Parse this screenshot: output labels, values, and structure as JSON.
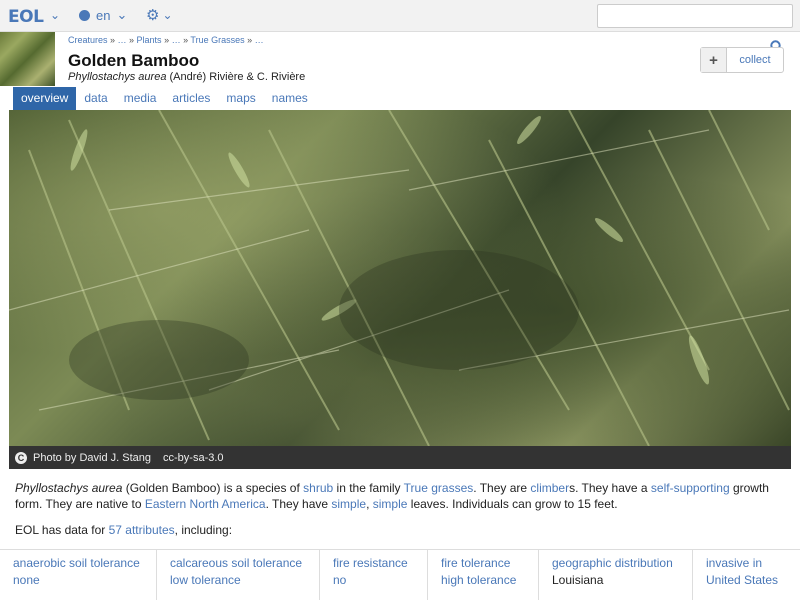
{
  "topbar": {
    "logo": "EOL",
    "language": "en"
  },
  "header": {
    "breadcrumb": [
      "Creatures",
      "…",
      "Plants",
      "…",
      "True Grasses",
      "…"
    ],
    "title": "Golden Bamboo",
    "scientific_name": "Phyllostachys aurea",
    "authority": "(André) Rivière & C. Rivière",
    "collect_label": "collect"
  },
  "tabs": [
    {
      "label": "overview",
      "active": true
    },
    {
      "label": "data",
      "active": false
    },
    {
      "label": "media",
      "active": false
    },
    {
      "label": "articles",
      "active": false
    },
    {
      "label": "maps",
      "active": false
    },
    {
      "label": "names",
      "active": false
    }
  ],
  "photo": {
    "credit": "Photo by David J. Stang",
    "license": "cc-by-sa-3.0"
  },
  "description": {
    "sci": "Phyllostachys aurea",
    "t1": " (Golden Bamboo) is a species of ",
    "l1": "shrub",
    "t2": " in the family ",
    "l2": "True grasses",
    "t3": ". They are ",
    "l3": "climber",
    "t4": "s. They have a ",
    "l4": "self-supporting",
    "t5": " growth form. They are native to ",
    "l5": "Eastern North America",
    "t6": ". They have ",
    "l6": "simple",
    "t7": ", ",
    "l7": "simple",
    "t8": " leaves. Individuals can grow to 15 feet."
  },
  "attributes_summary": {
    "prefix": "EOL has data for ",
    "link": "57 attributes",
    "suffix": ", including:"
  },
  "attributes": [
    {
      "key": "anaerobic soil tolerance",
      "value": "none",
      "value_link": true
    },
    {
      "key": "calcareous soil tolerance",
      "value": "low tolerance",
      "value_link": true
    },
    {
      "key": "fire resistance",
      "value": "no",
      "value_link": true
    },
    {
      "key": "fire tolerance",
      "value": "high tolerance",
      "value_link": true
    },
    {
      "key": "geographic distribution",
      "value": "Louisiana",
      "value_link": false
    },
    {
      "key": "invasive in",
      "value": "United States",
      "value_link": true
    }
  ],
  "colors": {
    "link": "#4a78b8",
    "active_tab": "#2f66a8"
  }
}
